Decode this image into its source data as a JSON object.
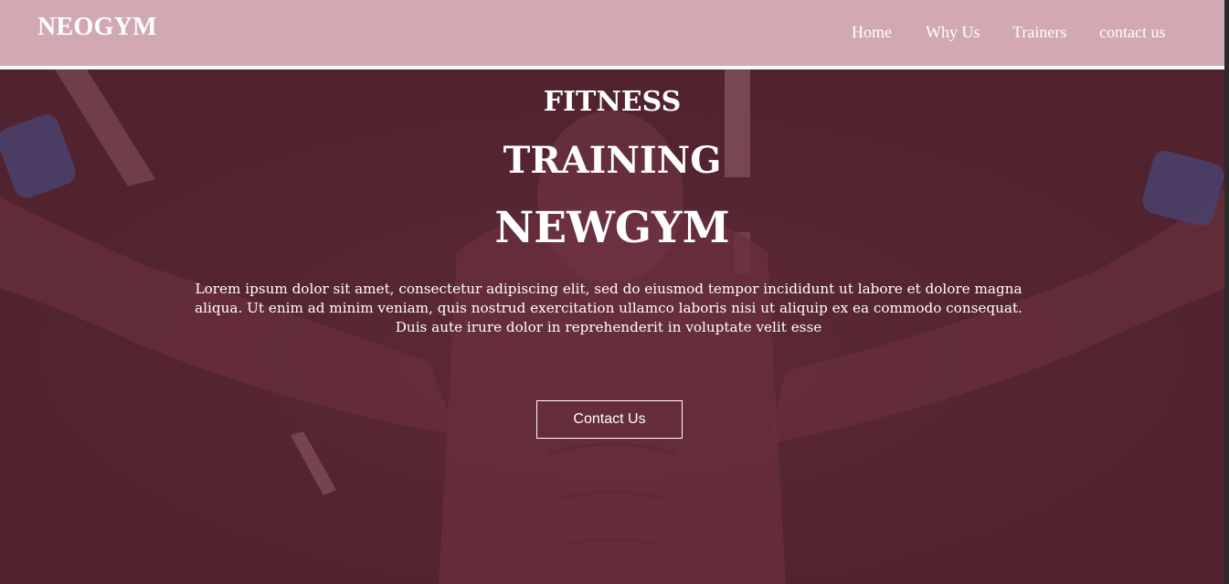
{
  "header": {
    "brand": "NEOGYM",
    "nav": [
      "Home",
      "Why Us",
      "Trainers",
      "contact us"
    ]
  },
  "hero": {
    "line1": "FITNESS",
    "line2": "TRAINING",
    "line3": "NEWGYM",
    "paragraph": "Lorem ipsum dolor sit amet, consectetur adipiscing elit, sed do eiusmod tempor incididunt ut labore et dolore magna aliqua. Ut enim ad minim veniam, quis nostrud exercitation ullamco laboris nisi ut aliquip ex ea commodo consequat. Duis aute irure dolor in reprehenderit in voluptate velit esse",
    "cta_label": "Contact Us"
  },
  "colors": {
    "header_bg": "#d2a8b3",
    "hero_overlay": "#51232f",
    "text": "#ffffff"
  }
}
